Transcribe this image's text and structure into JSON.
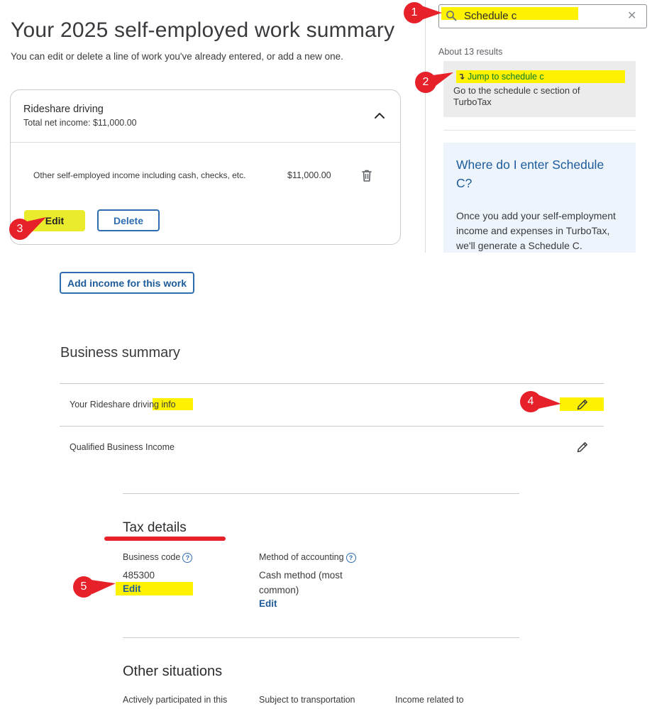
{
  "header": {
    "title": "Your 2025 self-employed work summary",
    "subtitle": "You can edit or delete a line of work you've already entered, or add a new one."
  },
  "work_card": {
    "title": "Rideshare driving",
    "net_income": "Total net income: $11,000.00",
    "income_line": {
      "label": "Other self-employed income including cash, checks, etc.",
      "amount": "$11,000.00"
    },
    "edit_label": "Edit",
    "delete_label": "Delete"
  },
  "add_income_label": "Add income for this work",
  "search": {
    "query": "Schedule c",
    "results_count": "About 13 results",
    "top_result": {
      "link": "Jump to schedule c",
      "description": "Go to the schedule c section of TurboTax"
    },
    "help_card": {
      "title": "Where do I enter Schedule C?",
      "body": "Once you add your self-employment income and expenses in TurboTax, we'll generate a Schedule C."
    }
  },
  "business_summary": {
    "title": "Business summary",
    "rows": [
      {
        "label": "Your Rideshare driving info"
      },
      {
        "label": "Qualified Business Income"
      }
    ]
  },
  "tax_details": {
    "title": "Tax details",
    "business_code_label": "Business code",
    "business_code_value": "485300",
    "business_code_edit": "Edit",
    "method_label": "Method of accounting",
    "method_value": "Cash method (most common)",
    "method_edit": "Edit"
  },
  "other_situations": {
    "title": "Other situations",
    "items": [
      "Actively participated in this",
      "Subject to transportation",
      "Income related to"
    ]
  },
  "callouts": [
    "1",
    "2",
    "3",
    "4",
    "5"
  ],
  "colors": {
    "highlight": "#fff200",
    "accent_blue": "#1d5b9a",
    "callout_red": "#e62129",
    "link_green": "#0b7a2c"
  },
  "icons": {
    "search": "search-icon",
    "clear": "close-icon",
    "collapse": "chevron-up-icon",
    "delete": "trash-icon",
    "edit": "pencil-icon",
    "help": "question-circle-icon"
  }
}
